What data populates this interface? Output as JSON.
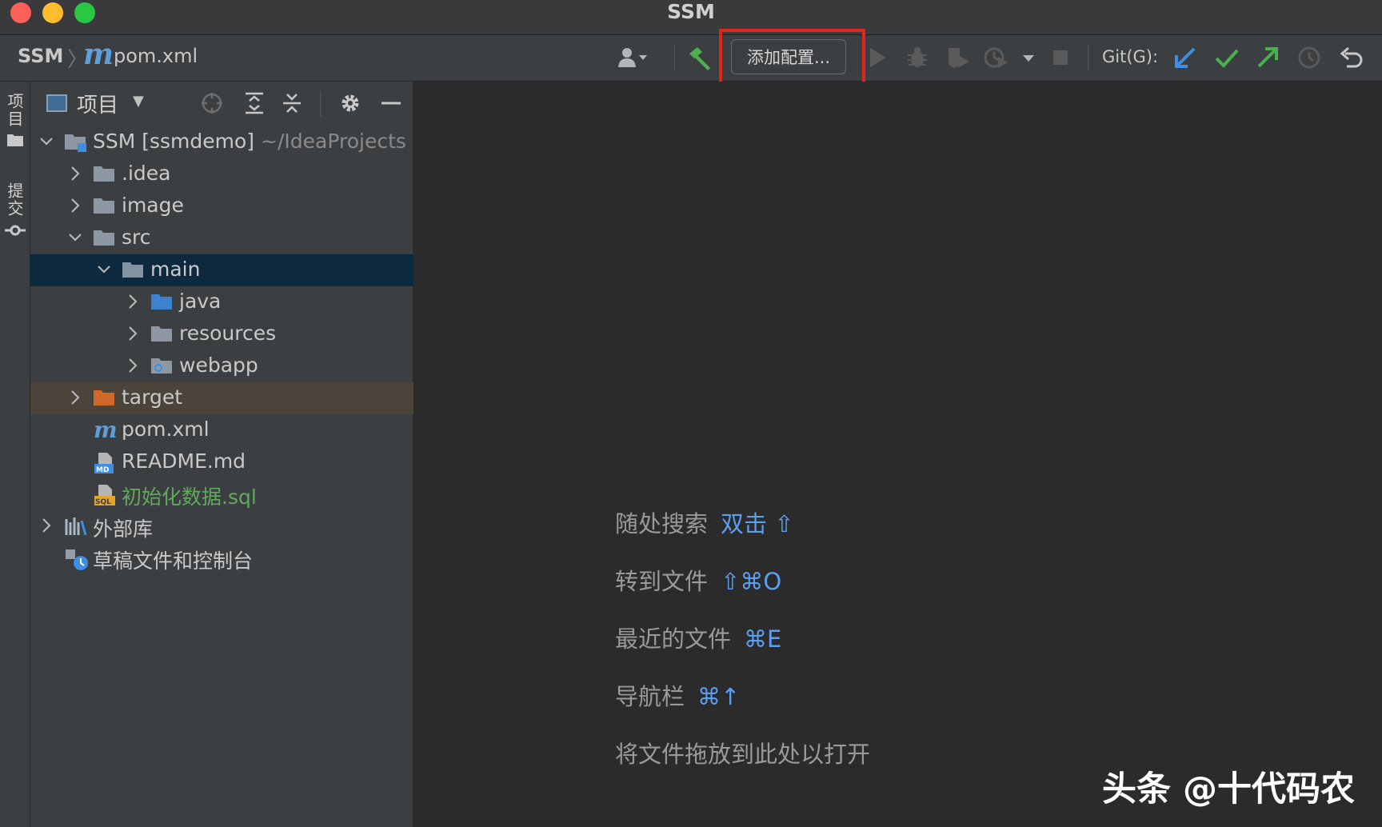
{
  "window": {
    "title": "SSM"
  },
  "breadcrumb": {
    "project": "SSM",
    "separator": "〉",
    "file_icon": "m",
    "file": "pom.xml"
  },
  "toolbar": {
    "add_config_label": "添加配置...",
    "git_label": "Git(G):"
  },
  "side_strip": {
    "project_tab": "项目",
    "commit_tab": "提交"
  },
  "project_panel": {
    "title": "项目",
    "tree": [
      {
        "label": "SSM [ssmdemo]",
        "hint": " ~/IdeaProjects",
        "level": 0,
        "chevron": "open",
        "icon": "module-folder"
      },
      {
        "label": ".idea",
        "level": 1,
        "chevron": "closed",
        "icon": "folder"
      },
      {
        "label": "image",
        "level": 1,
        "chevron": "closed",
        "icon": "folder"
      },
      {
        "label": "src",
        "level": 1,
        "chevron": "open",
        "icon": "folder"
      },
      {
        "label": "main",
        "level": 2,
        "chevron": "open",
        "icon": "folder",
        "state": "selected"
      },
      {
        "label": "java",
        "level": 3,
        "chevron": "closed",
        "icon": "source-folder"
      },
      {
        "label": "resources",
        "level": 3,
        "chevron": "closed",
        "icon": "folder"
      },
      {
        "label": "webapp",
        "level": 3,
        "chevron": "closed",
        "icon": "web-folder"
      },
      {
        "label": "target",
        "level": 1,
        "chevron": "closed",
        "icon": "excluded-folder",
        "state": "excluded"
      },
      {
        "label": "pom.xml",
        "level": 1,
        "chevron": "none",
        "icon": "maven-file"
      },
      {
        "label": "README.md",
        "level": 1,
        "chevron": "none",
        "icon": "md-file"
      },
      {
        "label": "初始化数据.sql",
        "level": 1,
        "chevron": "none",
        "icon": "sql-file",
        "color": "green"
      },
      {
        "label": "外部库",
        "level": 0,
        "chevron": "closed",
        "icon": "library"
      },
      {
        "label": "草稿文件和控制台",
        "level": 0,
        "chevron": "none",
        "icon": "scratch"
      }
    ]
  },
  "editor_hints": [
    {
      "text": "随处搜索",
      "key": "双击 ⇧"
    },
    {
      "text": "转到文件",
      "key": "⇧⌘O"
    },
    {
      "text": "最近的文件",
      "key": "⌘E"
    },
    {
      "text": "导航栏",
      "key": "⌘↑"
    },
    {
      "text": "将文件拖放到此处以打开",
      "key": ""
    }
  ],
  "watermark": "头条 @十代码农",
  "colors": {
    "accent_blue": "#5c9ff0",
    "selection": "#0d293e",
    "excluded": "#4a443a",
    "highlight_box": "#e0261c",
    "git_green": "#4caf50"
  }
}
